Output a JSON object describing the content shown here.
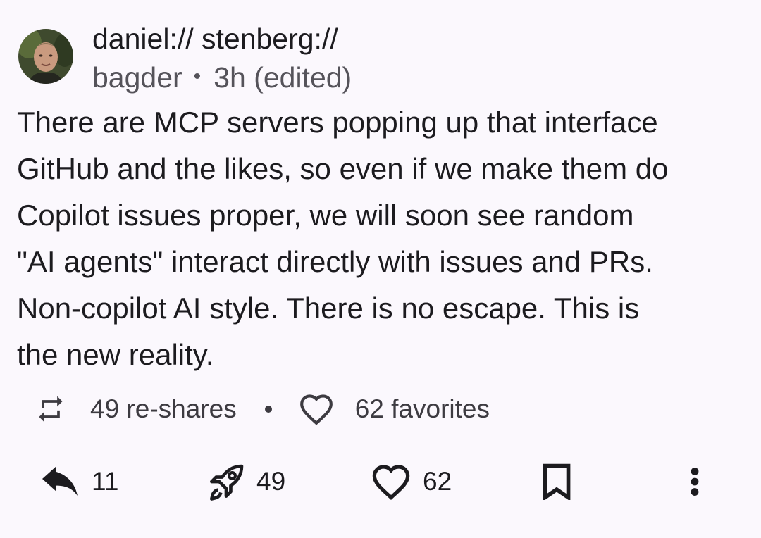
{
  "author": {
    "display_name": "daniel:// stenberg://",
    "handle": "bagder",
    "timestamp": "3h (edited)",
    "separator": "•"
  },
  "post": {
    "lines": [
      "There are MCP servers popping up that interface",
      "GitHub and the likes, so even if we make them do",
      "Copilot issues proper, we will soon see random",
      "\"AI agents\" interact directly with issues and PRs.",
      "Non-copilot AI style. There is no escape. This is",
      "the new reality."
    ]
  },
  "stats": {
    "reshares_label": "49 re-shares",
    "favorites_label": "62 favorites"
  },
  "actions": {
    "reply_count": "11",
    "boost_count": "49",
    "favorite_count": "62"
  },
  "icons": {
    "reshare": "reshare-icon",
    "favorite": "heart-icon",
    "reply": "reply-icon",
    "boost": "rocket-icon",
    "bookmark": "bookmark-icon",
    "more": "more-vertical-icon"
  }
}
